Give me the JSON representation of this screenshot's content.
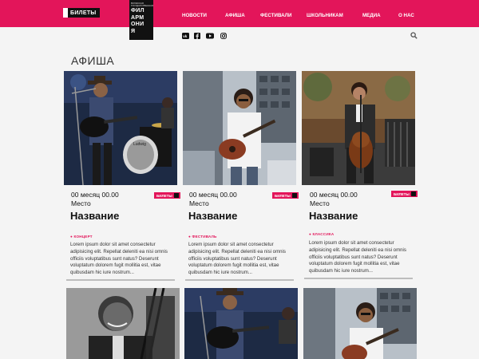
{
  "header": {
    "tickets_label": "БИЛЕТЫ",
    "logo_small": [
      "ВОЛЖСКАЯ",
      "ГОСУДАРСТВЕННАЯ"
    ],
    "logo_big": [
      "ФИЛ",
      "АРМ",
      "ОНИ",
      "Я"
    ],
    "nav": [
      "НОВОСТИ",
      "АФИША",
      "ФЕСТИВАЛИ",
      "ШКОЛЬНИКАМ",
      "МЕДИА",
      "О НАС"
    ]
  },
  "social_icons": [
    "vk-icon",
    "facebook-icon",
    "youtube-icon",
    "instagram-icon"
  ],
  "page_title": "АФИША",
  "cards": [
    {
      "date": "00 месяц 00.00",
      "place": "Место",
      "name": "Название",
      "tag": "КОНЦЕРТ",
      "badge": "БИЛЕТЫ",
      "desc": "Lorem ipsum dolor sit amet consectetur adipisicing elit. Repellat deleniti ea nisi omnis officiis voluptatibus sunt natus? Deserunt voluptatum dolorem fugit mollitia est, vitae quibusdam hic iure nostrum..."
    },
    {
      "date": "00 месяц 00.00",
      "place": "Место",
      "name": "Название",
      "tag": "ФЕСТИВАЛЬ",
      "badge": "БИЛЕТЫ",
      "desc": "Lorem ipsum dolor sit amet consectetur adipisicing elit. Repellat deleniti ea nisi omnis officiis voluptatibus sunt natus? Deserunt voluptatum dolorem fugit mollitia est, vitae quibusdam hic iure nostrum..."
    },
    {
      "date": "00 месяц 00.00",
      "place": "Место",
      "name": "Название",
      "tag": "КЛАССИКА",
      "badge": "БИЛЕТЫ",
      "desc": "Lorem ipsum dolor sit amet consectetur adipisicing elit. Repellat deleniti ea nisi omnis officiis voluptatibus sunt natus? Deserunt voluptatum dolorem fugit mollitia est, vitae quibusdam hic iure nostrum..."
    }
  ],
  "colors": {
    "accent": "#e3155a",
    "dark": "#111111",
    "background": "#f4f4f4"
  }
}
